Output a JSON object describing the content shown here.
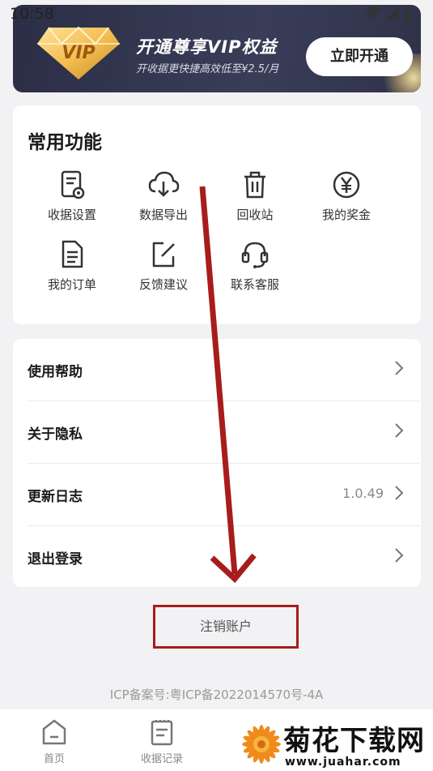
{
  "status_bar": {
    "time": "10:58"
  },
  "vip": {
    "badge_text": "VIP",
    "title": "开通尊享VIP权益",
    "subtitle": "开收据更快捷高效低至¥2.5/月",
    "button": "立即开通"
  },
  "functions": {
    "title": "常用功能",
    "items": [
      {
        "label": "收据设置",
        "icon": "receipt-settings-icon"
      },
      {
        "label": "数据导出",
        "icon": "cloud-download-icon"
      },
      {
        "label": "回收站",
        "icon": "trash-icon"
      },
      {
        "label": "我的奖金",
        "icon": "yen-icon"
      },
      {
        "label": "我的订单",
        "icon": "document-icon"
      },
      {
        "label": "反馈建议",
        "icon": "edit-icon"
      },
      {
        "label": "联系客服",
        "icon": "headset-icon"
      }
    ]
  },
  "menu": {
    "items": [
      {
        "label": "使用帮助"
      },
      {
        "label": "关于隐私"
      },
      {
        "label": "更新日志",
        "value": "1.0.49"
      },
      {
        "label": "退出登录"
      }
    ]
  },
  "cancel_account": "注销账户",
  "icp": "ICP备案号:粤ICP备2022014570号-4A",
  "bottom_nav": [
    {
      "label": "首页",
      "icon": "home-icon"
    },
    {
      "label": "收据记录",
      "icon": "records-icon"
    }
  ],
  "watermark": {
    "title": "菊花下载网",
    "url": "www.juahar.com"
  },
  "colors": {
    "annotation_red": "#a81c1c",
    "banner_bg": "#2b2e45",
    "gold": "#e8b24a"
  }
}
